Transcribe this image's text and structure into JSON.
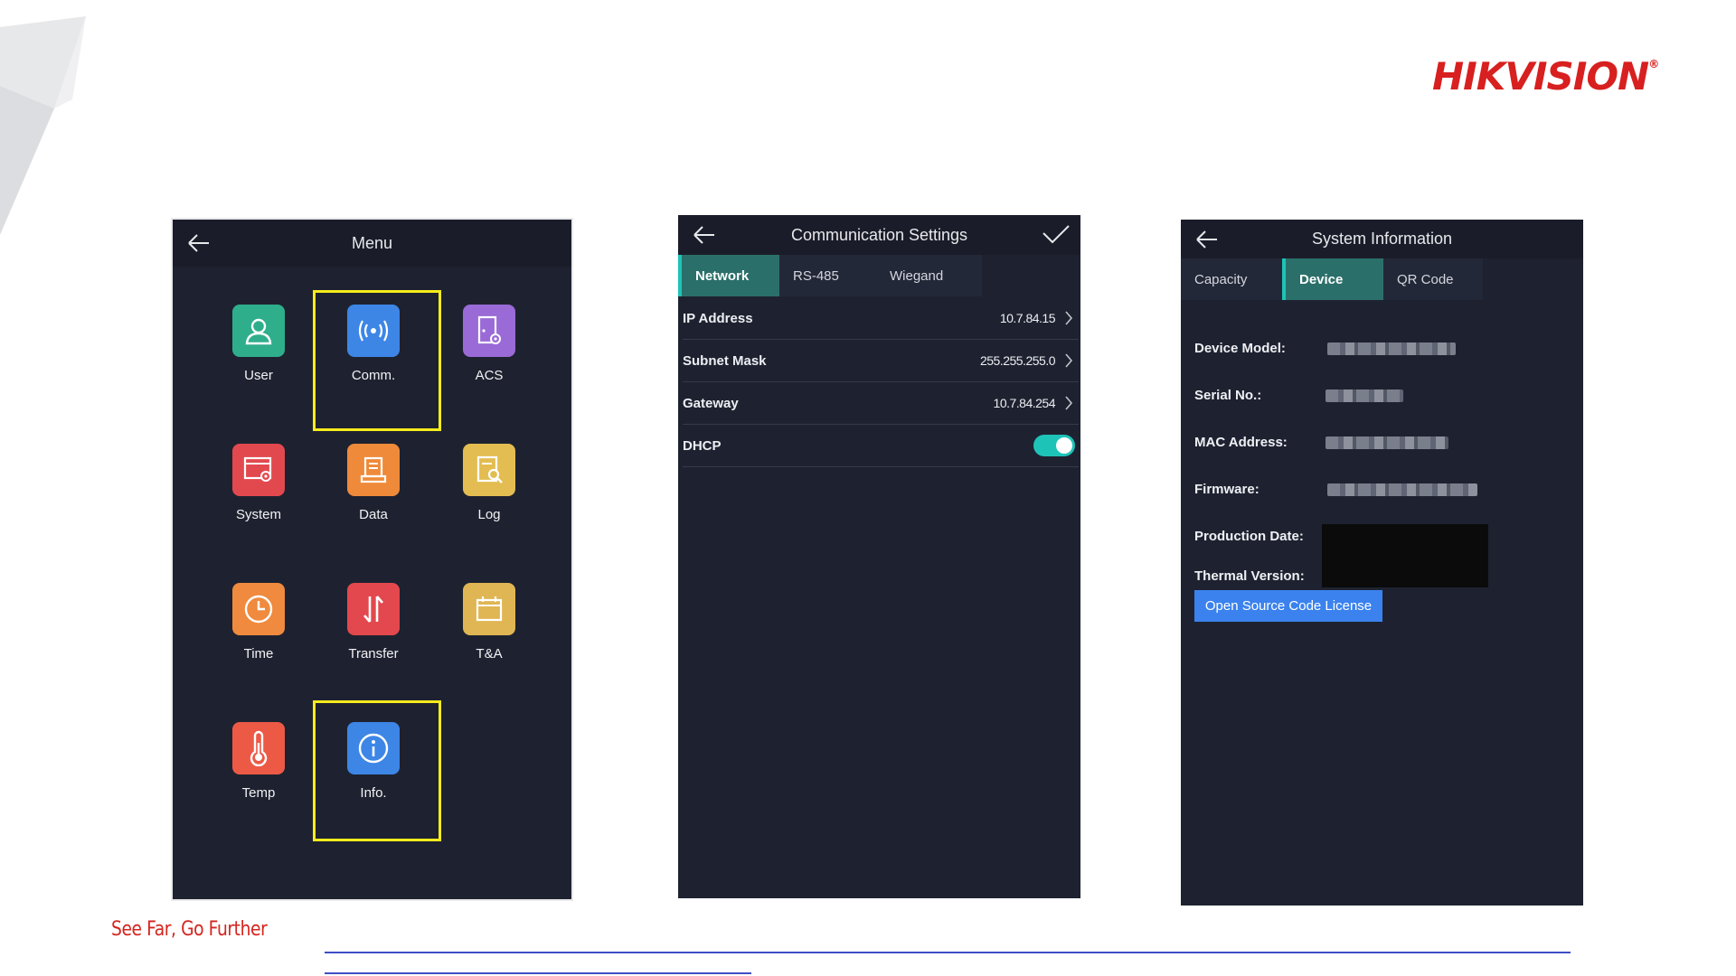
{
  "brand": {
    "logo": "HIKVISION",
    "slogan": "See Far, Go Further"
  },
  "menu_screen": {
    "title": "Menu",
    "items": [
      {
        "label": "User",
        "icon": "user-icon",
        "color": "#2fae8c"
      },
      {
        "label": "Comm.",
        "icon": "wireless-signal-icon",
        "color": "#3d86e6",
        "highlighted": true
      },
      {
        "label": "ACS",
        "icon": "acs-door-gear-icon",
        "color": "#9a6ad6"
      },
      {
        "label": "System",
        "icon": "system-settings-icon",
        "color": "#e2494f"
      },
      {
        "label": "Data",
        "icon": "data-document-icon",
        "color": "#ee8a3a"
      },
      {
        "label": "Log",
        "icon": "log-search-icon",
        "color": "#e3bd52"
      },
      {
        "label": "Time",
        "icon": "clock-icon",
        "color": "#ef8a3e"
      },
      {
        "label": "Transfer",
        "icon": "transfer-arrows-icon",
        "color": "#e2484d"
      },
      {
        "label": "T&A",
        "icon": "calendar-icon",
        "color": "#e0b654"
      },
      {
        "label": "Temp",
        "icon": "thermometer-icon",
        "color": "#ec5a46"
      },
      {
        "label": "Info.",
        "icon": "info-icon",
        "color": "#3d86e6",
        "highlighted": true
      }
    ],
    "highlight_color": "#f6ec1c"
  },
  "comm_screen": {
    "title": "Communication Settings",
    "tabs": [
      "Network",
      "RS-485",
      "Wiegand"
    ],
    "active_tab": "Network",
    "rows": [
      {
        "label": "IP Address",
        "value": "10.7.84.15"
      },
      {
        "label": "Subnet Mask",
        "value": "255.255.255.0"
      },
      {
        "label": "Gateway",
        "value": "10.7.84.254"
      }
    ],
    "dhcp": {
      "label": "DHCP",
      "enabled": true
    },
    "accent": "#1ec3b8"
  },
  "sysinfo_screen": {
    "title": "System Information",
    "tabs": [
      "Capacity",
      "Device",
      "QR Code"
    ],
    "active_tab": "Device",
    "fields": [
      {
        "label": "Device Model:"
      },
      {
        "label": "Serial No.:"
      },
      {
        "label": "MAC Address:"
      },
      {
        "label": "Firmware:"
      },
      {
        "label": "Production Date:"
      },
      {
        "label": "Thermal Version:"
      }
    ],
    "license_button": "Open Source Code License",
    "button_color": "#3b82ee"
  }
}
